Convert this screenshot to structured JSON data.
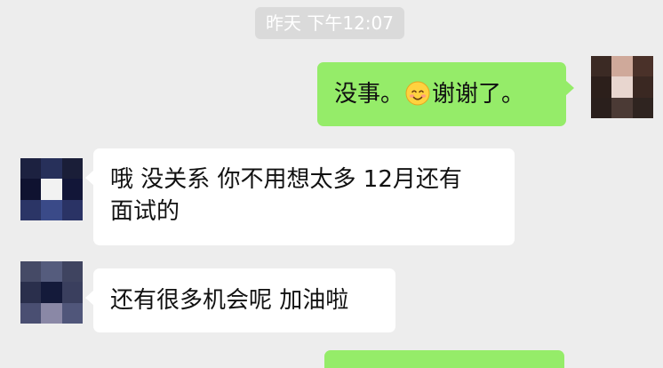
{
  "chat": {
    "timestamp": "昨天 下午12:07",
    "messages": [
      {
        "sender": "me",
        "text_before": "没事。",
        "emoji": "smiling-face-with-blush-icon",
        "text_after": "谢谢了。"
      },
      {
        "sender": "friend",
        "line1": "哦 没关系 你不用想太多 12月还有",
        "line2": "面试的"
      },
      {
        "sender": "friend",
        "text": "还有很多机会呢 加油啦"
      }
    ]
  },
  "colors": {
    "background": "#ededed",
    "timestamp_bg": "#dadada",
    "outgoing_bubble": "#95ec69",
    "incoming_bubble": "#ffffff",
    "text": "#111111"
  }
}
